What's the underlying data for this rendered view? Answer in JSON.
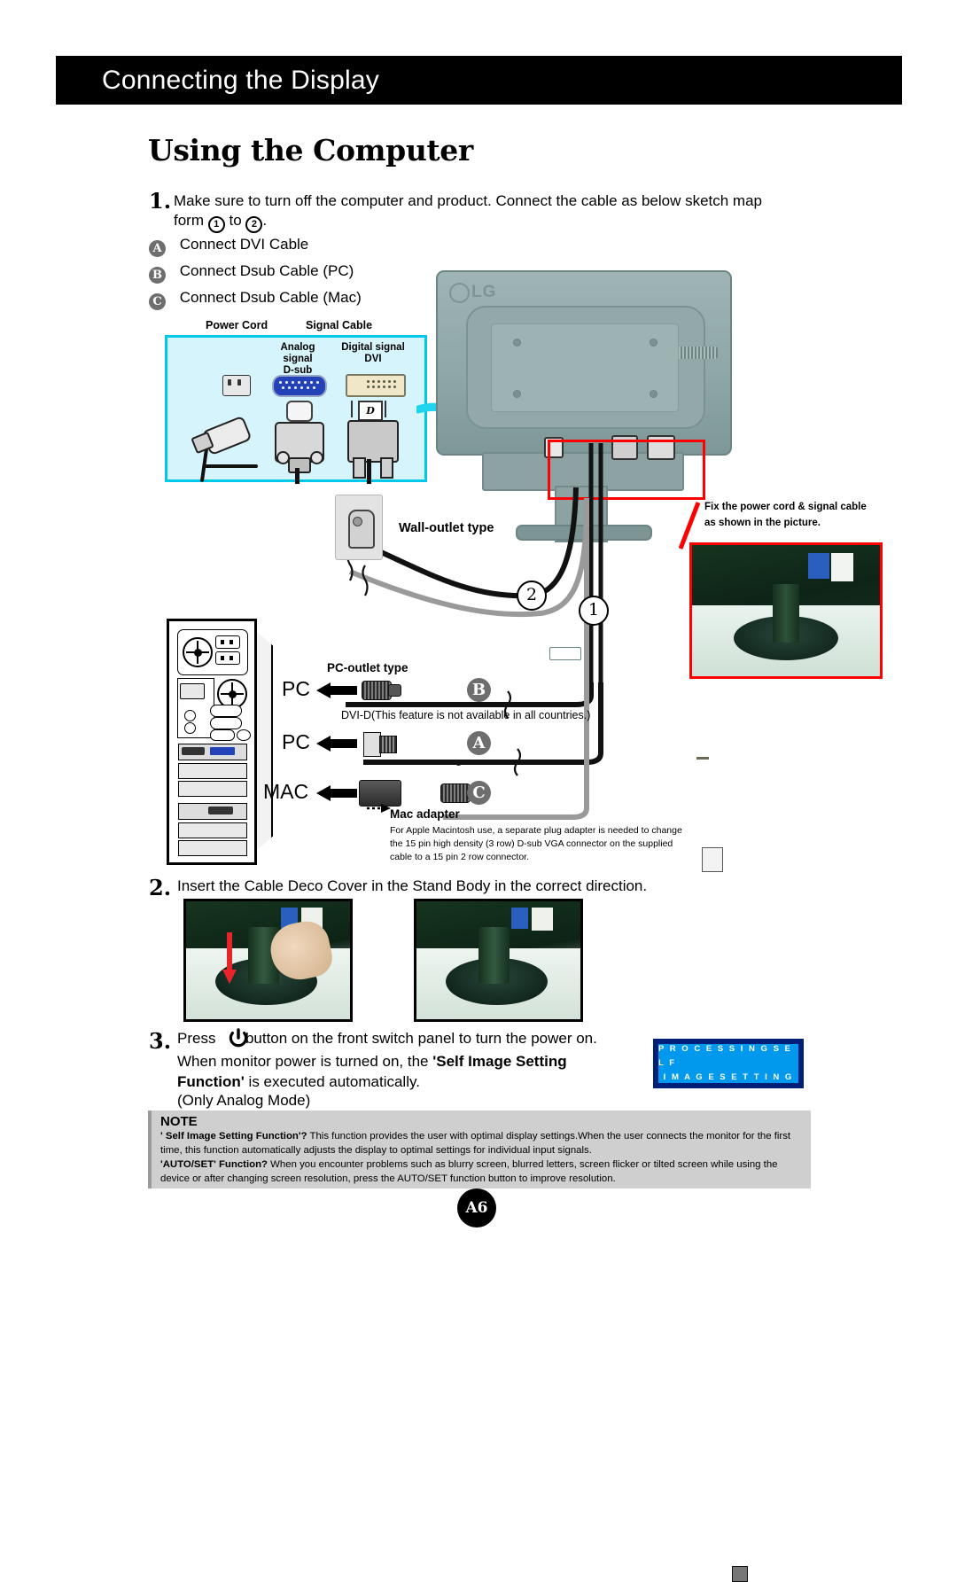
{
  "header": {
    "title": "Connecting the Display"
  },
  "page_title": "Using the Computer",
  "steps": {
    "one": {
      "num": "1.",
      "text": "Make sure to turn off the computer and  product. Connect the cable as below sketch map",
      "text2_pre": "form",
      "circle1": "1",
      "text2_mid": "to",
      "circle2": "2",
      "text2_post": "."
    },
    "two": {
      "num": "2.",
      "text": "Insert the Cable Deco Cover in the Stand Body in the correct direction."
    },
    "three": {
      "num": "3.",
      "line1_pre": "Press",
      "power_icon": "power-icon",
      "line1_post": "button on the front switch panel to turn the power on.",
      "line2_pre": "When monitor power is turned on, the",
      "line2_bold": "'Self Image Setting",
      "line3_bold": "Function'",
      "line3_post": "is executed automatically.",
      "line4": "(Only Analog Mode)"
    }
  },
  "cable_options": [
    {
      "badge": "A",
      "label": "Connect DVI Cable"
    },
    {
      "badge": "B",
      "label": "Connect Dsub Cable (PC)"
    },
    {
      "badge": "C",
      "label": "Connect Dsub Cable (Mac)"
    }
  ],
  "legend": {
    "power_cord": "Power Cord",
    "signal_cable": "Signal Cable",
    "analog_line1": "Analog signal",
    "analog_line2": "D-sub",
    "digital_line1": "Digital signal",
    "digital_line2": "DVI",
    "dvi_mark": "D"
  },
  "monitor": {
    "brand": "LG"
  },
  "callouts": {
    "wall_outlet": "Wall-outlet type",
    "pc_outlet": "PC-outlet type",
    "dvi_d": "DVI-D(This feature is not available in all countries.)",
    "mac_adapter_title": "Mac adapter",
    "mac_adapter_note": "For Apple Macintosh use, a  separate plug adapter is needed to change the 15 pin high density (3 row) D-sub VGA connector on the supplied cable to a 15 pin  2 row connector.",
    "fix_cable_line1": "Fix the power cord & signal cable",
    "fix_cable_line2": "as shown in the picture."
  },
  "device_labels": {
    "pc1": "PC",
    "pc2": "PC",
    "mac": "MAC"
  },
  "cable_badges": {
    "b": "B",
    "a": "A",
    "c": "C"
  },
  "cable_numbers": {
    "one": "1",
    "two": "2"
  },
  "osd": {
    "line1": "P R O C E S S I N G   S E L F",
    "line2": "I M A G E   S E T T I N G"
  },
  "note": {
    "title": "NOTE",
    "p1_bold": "' Self Image Setting Function'?",
    "p1_text": " This function provides the user with optimal display settings.When the user connects the monitor for the first time, this function automatically adjusts the display to optimal settings for individual input signals.",
    "p2_bold": "'AUTO/SET' Function?",
    "p2_text": " When you encounter problems such as blurry screen, blurred letters, screen flicker or tilted screen while using the device or after changing screen resolution, press the AUTO/SET function button to improve resolution."
  },
  "page_number": "A6",
  "colors": {
    "accent_cyan": "#00c8e8",
    "red": "#ff0000",
    "osd_blue": "#0099ee",
    "osd_border": "#001f78"
  }
}
